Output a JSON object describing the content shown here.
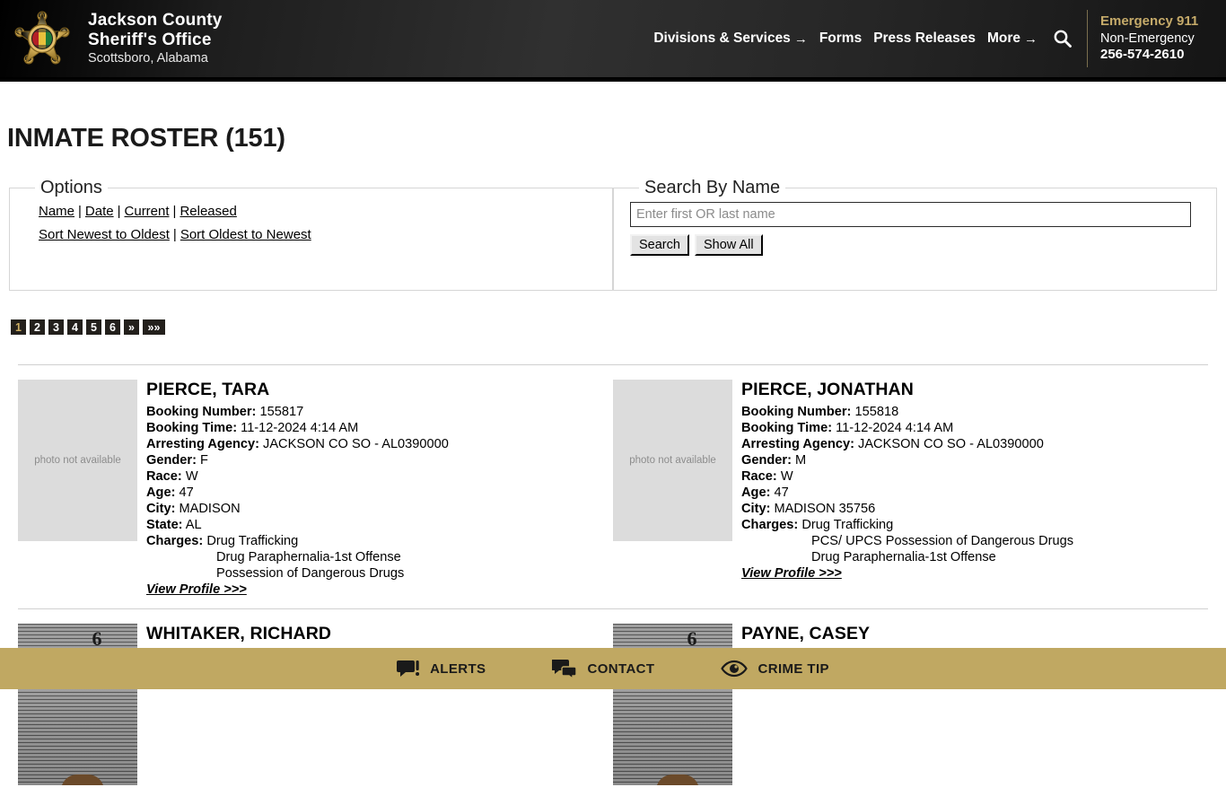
{
  "header": {
    "brand_line1": "Jackson County",
    "brand_line2": "Sheriff's Office",
    "brand_line3": "Scottsboro, Alabama",
    "nav": [
      {
        "label": "Divisions & Services",
        "arrow": "→"
      },
      {
        "label": "Forms",
        "arrow": ""
      },
      {
        "label": "Press Releases",
        "arrow": ""
      },
      {
        "label": "More",
        "arrow": "→"
      }
    ],
    "search_icon": "search-icon",
    "emergency_label": "Emergency 911",
    "non_emergency_label": "Non-Emergency",
    "non_emergency_phone": "256-574-2610",
    "accent_gold": "#c6ab6a",
    "background": "#1c1c1c"
  },
  "page_title": "INMATE ROSTER (151)",
  "options_panel": {
    "legend": "Options",
    "row1": [
      {
        "label": "Name"
      },
      {
        "label": "Date"
      },
      {
        "label": "Current"
      },
      {
        "label": "Released"
      }
    ],
    "row2": [
      {
        "label": "Sort Newest to Oldest"
      },
      {
        "label": "Sort Oldest to Newest"
      }
    ],
    "separator": "|"
  },
  "search_panel": {
    "legend": "Search By Name",
    "input_value": "",
    "placeholder": "Enter first OR last name",
    "search_button": "Search",
    "show_all_button": "Show All"
  },
  "pagination": {
    "pages": [
      "1",
      "2",
      "3",
      "4",
      "5",
      "6"
    ],
    "active": "1",
    "next": "»",
    "last": "»»",
    "active_color": "#cdae63",
    "background": "#23201c"
  },
  "roster": {
    "photo_placeholder_text": "photo not available",
    "view_profile_label": "View Profile >>>",
    "labels": {
      "booking_number": "Booking Number:",
      "booking_time": "Booking Time:",
      "arresting_agency": "Arresting Agency:",
      "gender": "Gender:",
      "race": "Race:",
      "age": "Age:",
      "city": "City:",
      "state": "State:",
      "charges": "Charges:"
    },
    "rows": [
      {
        "inmates": [
          {
            "name": "PIERCE, TARA",
            "photo": "placeholder",
            "booking_number": "155817",
            "booking_time": "11-12-2024 4:14 AM",
            "arresting_agency": "JACKSON CO SO - AL0390000",
            "gender": "F",
            "race": "W",
            "age": "47",
            "city": "MADISON",
            "state": "AL",
            "charges": [
              "Drug Trafficking",
              "Drug Paraphernalia-1st Offense",
              "Possession of Dangerous Drugs"
            ]
          },
          {
            "name": "PIERCE, JONATHAN",
            "photo": "placeholder",
            "booking_number": "155818",
            "booking_time": "11-12-2024 4:14 AM",
            "arresting_agency": "JACKSON CO SO - AL0390000",
            "gender": "M",
            "race": "W",
            "age": "47",
            "city": "MADISON 35756",
            "state": "",
            "charges": [
              "Drug Trafficking",
              "PCS/ UPCS Possession of Dangerous Drugs",
              "Drug Paraphernalia-1st Offense"
            ]
          }
        ]
      },
      {
        "inmates": [
          {
            "name": "WHITAKER, RICHARD",
            "photo": "mugshot",
            "ruler_mark": "6"
          },
          {
            "name": "PAYNE, CASEY",
            "photo": "mugshot",
            "ruler_mark": "6"
          }
        ]
      }
    ]
  },
  "bottom_bar": {
    "background": "#c0a862",
    "items": [
      {
        "label": "ALERTS",
        "icon": "alert-bubble-icon"
      },
      {
        "label": "CONTACT",
        "icon": "chat-bubbles-icon"
      },
      {
        "label": "CRIME TIP",
        "icon": "eye-icon"
      }
    ]
  }
}
